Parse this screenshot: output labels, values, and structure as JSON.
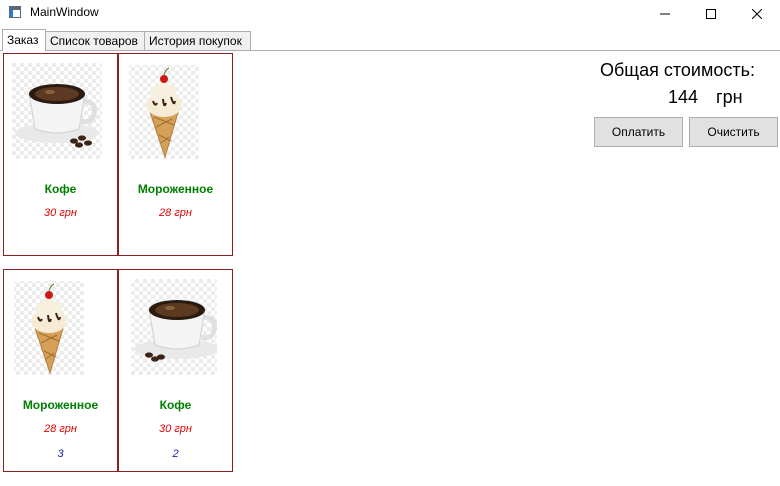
{
  "window": {
    "title": "MainWindow"
  },
  "tabs": [
    "Заказ",
    "Список товаров",
    "История покупок"
  ],
  "products": [
    {
      "name": "Кофе",
      "price": "30 грн",
      "image": "coffee-cup"
    },
    {
      "name": "Мороженное",
      "price": "28 грн",
      "image": "ice-cream-cone"
    }
  ],
  "order": [
    {
      "name": "Мороженное",
      "price": "28 грн",
      "qty": "3",
      "image": "ice-cream-cone"
    },
    {
      "name": "Кофе",
      "price": "30 грн",
      "qty": "2",
      "image": "coffee-cup"
    }
  ],
  "summary": {
    "label": "Общая стоимость:",
    "value": "144",
    "currency": "грн"
  },
  "buttons": {
    "pay": "Оплатить",
    "clear": "Очистить"
  }
}
